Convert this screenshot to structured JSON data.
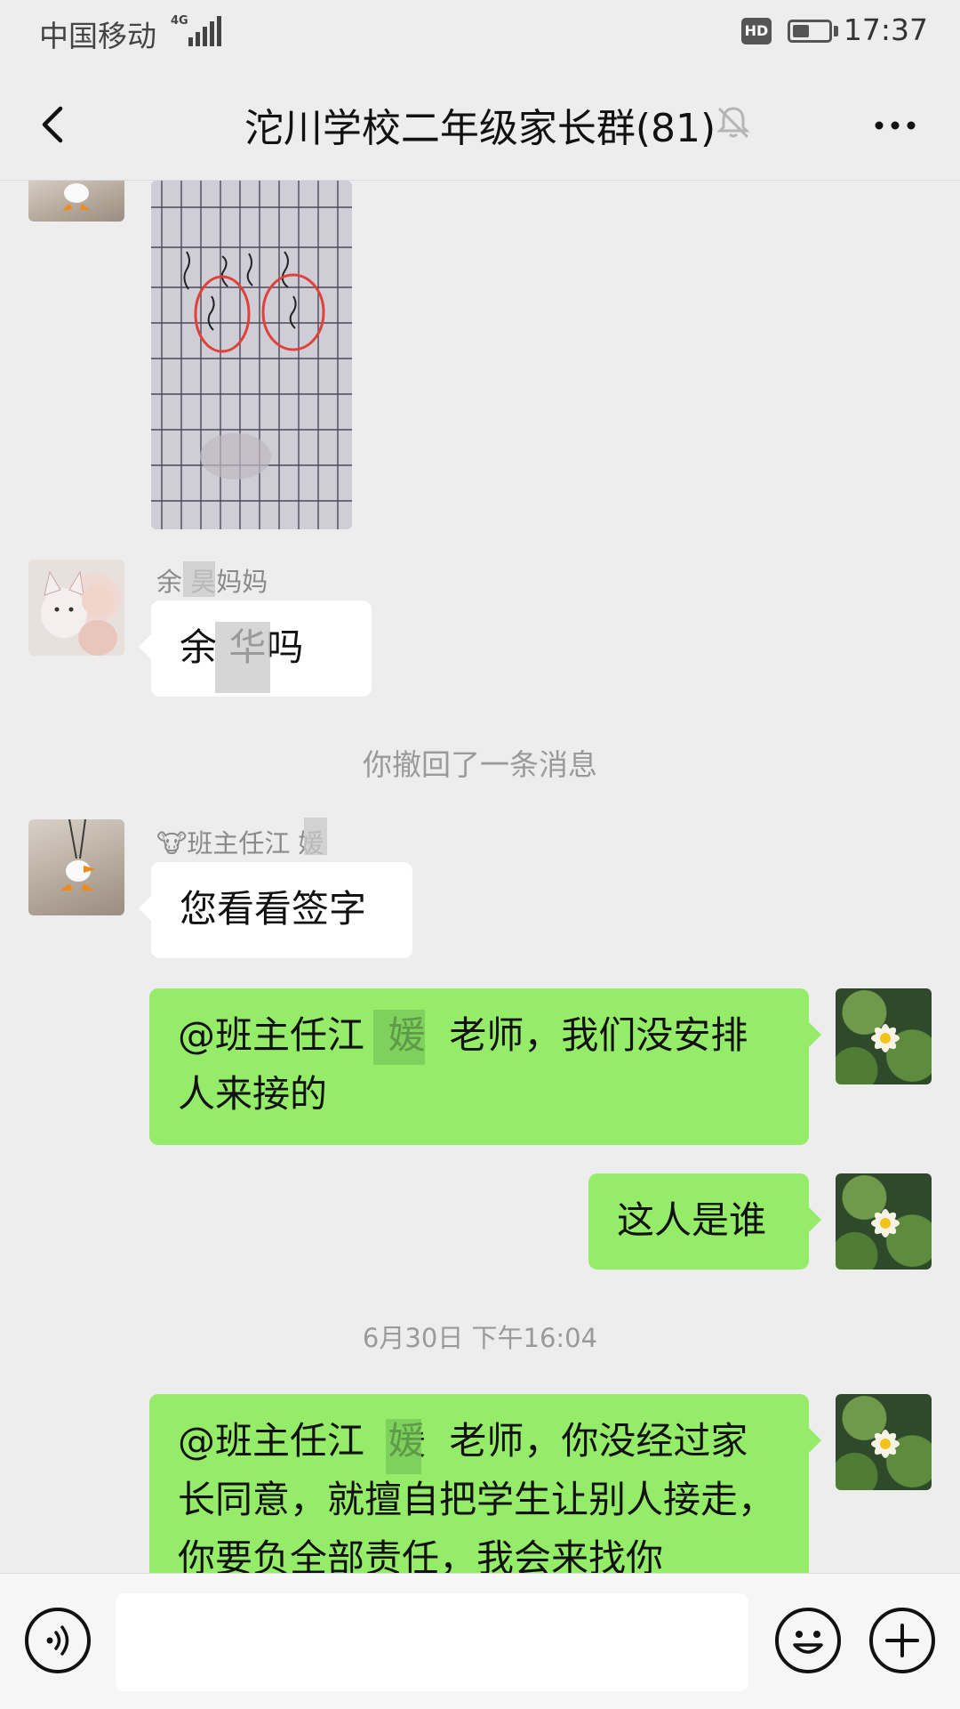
{
  "status_bar": {
    "carrier": "中国移动",
    "network": "4G",
    "hd": "HD",
    "time": "17:37",
    "battery_level": 0.4
  },
  "header": {
    "title": "沱川学校二年级家长群(81)",
    "back_icon": "chevron-left-icon",
    "mute_icon": "bell-off-icon",
    "more_icon": "more-horizontal-icon"
  },
  "messages": [
    {
      "type": "image",
      "side": "left",
      "avatar": "duck-avatar",
      "alt_content": "signed-attendance-sheet-photo"
    },
    {
      "type": "text",
      "side": "left",
      "sender": "余 昊妈妈",
      "text": "余 华吗",
      "avatar": "cat-avatar"
    },
    {
      "type": "system",
      "text": "你撤回了一条消息"
    },
    {
      "type": "text",
      "side": "left",
      "sender_emoji": "🐮",
      "sender": "班主任江 媛",
      "text": "您看看签字",
      "avatar": "duck-avatar"
    },
    {
      "type": "text",
      "side": "right",
      "text": "@班主任江  媛  老师，我们没安排人来接的",
      "avatar": "waterlily-avatar"
    },
    {
      "type": "text",
      "side": "right",
      "text": "这人是谁",
      "avatar": "waterlily-avatar"
    },
    {
      "type": "timestamp",
      "text": "6月30日 下午16:04"
    },
    {
      "type": "text",
      "side": "right",
      "text": "@班主任江  媛  老师，你没经过家长同意，就擅自把学生让别人接走，你要负全部责任，我会来找你",
      "avatar": "waterlily-avatar"
    }
  ],
  "input_bar": {
    "voice_icon": "voice-icon",
    "emoji_icon": "emoji-icon",
    "plus_icon": "plus-icon",
    "placeholder": ""
  },
  "colors": {
    "background": "#ededed",
    "bubble_self": "#95ec69",
    "bubble_other": "#ffffff"
  }
}
